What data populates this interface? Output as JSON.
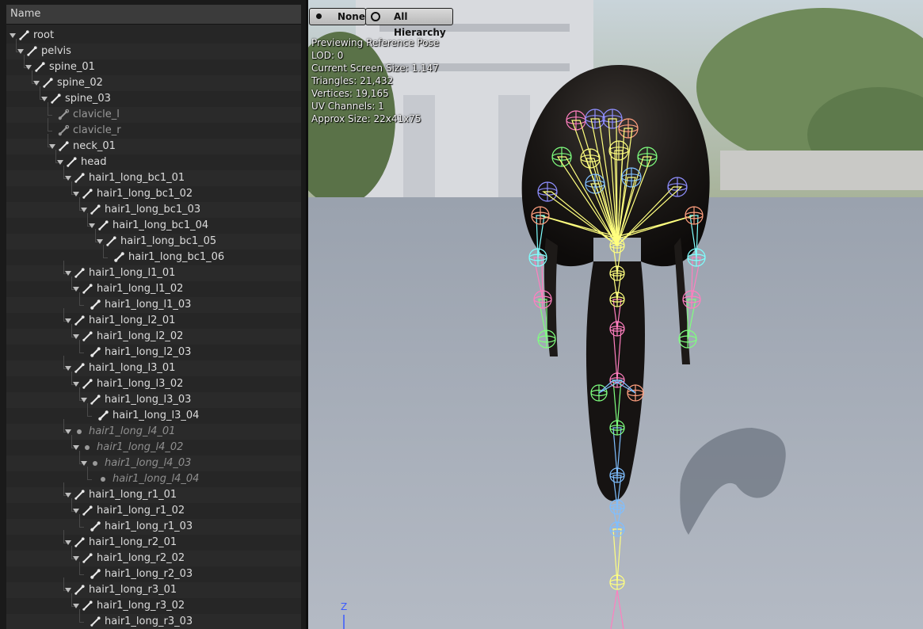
{
  "tree": {
    "header": "Name",
    "rows": [
      {
        "label": "root",
        "depth": 0,
        "expanded": true,
        "icon": "bone",
        "style": "normal"
      },
      {
        "label": "pelvis",
        "depth": 1,
        "expanded": true,
        "icon": "bone",
        "style": "normal"
      },
      {
        "label": "spine_01",
        "depth": 2,
        "expanded": true,
        "icon": "bone",
        "style": "normal"
      },
      {
        "label": "spine_02",
        "depth": 3,
        "expanded": true,
        "icon": "bone",
        "style": "normal"
      },
      {
        "label": "spine_03",
        "depth": 4,
        "expanded": true,
        "icon": "bone",
        "style": "normal"
      },
      {
        "label": "clavicle_l",
        "depth": 5,
        "expanded": false,
        "icon": "bone-outline",
        "style": "disabled"
      },
      {
        "label": "clavicle_r",
        "depth": 5,
        "expanded": false,
        "icon": "bone-outline",
        "style": "disabled"
      },
      {
        "label": "neck_01",
        "depth": 5,
        "expanded": true,
        "icon": "bone",
        "style": "normal"
      },
      {
        "label": "head",
        "depth": 6,
        "expanded": true,
        "icon": "bone",
        "style": "normal"
      },
      {
        "label": "hair1_long_bc1_01",
        "depth": 7,
        "expanded": true,
        "icon": "bone",
        "style": "normal"
      },
      {
        "label": "hair1_long_bc1_02",
        "depth": 8,
        "expanded": true,
        "icon": "bone",
        "style": "normal"
      },
      {
        "label": "hair1_long_bc1_03",
        "depth": 9,
        "expanded": true,
        "icon": "bone",
        "style": "normal"
      },
      {
        "label": "hair1_long_bc1_04",
        "depth": 10,
        "expanded": true,
        "icon": "bone",
        "style": "normal"
      },
      {
        "label": "hair1_long_bc1_05",
        "depth": 11,
        "expanded": true,
        "icon": "bone",
        "style": "normal"
      },
      {
        "label": "hair1_long_bc1_06",
        "depth": 12,
        "expanded": false,
        "icon": "bone-end",
        "style": "normal"
      },
      {
        "label": "hair1_long_l1_01",
        "depth": 7,
        "expanded": true,
        "icon": "bone",
        "style": "normal"
      },
      {
        "label": "hair1_long_l1_02",
        "depth": 8,
        "expanded": true,
        "icon": "bone",
        "style": "normal"
      },
      {
        "label": "hair1_long_l1_03",
        "depth": 9,
        "expanded": false,
        "icon": "bone-end",
        "style": "normal"
      },
      {
        "label": "hair1_long_l2_01",
        "depth": 7,
        "expanded": true,
        "icon": "bone",
        "style": "normal"
      },
      {
        "label": "hair1_long_l2_02",
        "depth": 8,
        "expanded": true,
        "icon": "bone",
        "style": "normal"
      },
      {
        "label": "hair1_long_l2_03",
        "depth": 9,
        "expanded": false,
        "icon": "bone-end",
        "style": "normal"
      },
      {
        "label": "hair1_long_l3_01",
        "depth": 7,
        "expanded": true,
        "icon": "bone",
        "style": "normal"
      },
      {
        "label": "hair1_long_l3_02",
        "depth": 8,
        "expanded": true,
        "icon": "bone",
        "style": "normal"
      },
      {
        "label": "hair1_long_l3_03",
        "depth": 9,
        "expanded": true,
        "icon": "bone",
        "style": "normal"
      },
      {
        "label": "hair1_long_l3_04",
        "depth": 10,
        "expanded": false,
        "icon": "bone-end",
        "style": "normal"
      },
      {
        "label": "hair1_long_l4_01",
        "depth": 7,
        "expanded": true,
        "icon": "dot",
        "style": "italic"
      },
      {
        "label": "hair1_long_l4_02",
        "depth": 8,
        "expanded": true,
        "icon": "dot",
        "style": "italic"
      },
      {
        "label": "hair1_long_l4_03",
        "depth": 9,
        "expanded": true,
        "icon": "dot",
        "style": "italic"
      },
      {
        "label": "hair1_long_l4_04",
        "depth": 10,
        "expanded": false,
        "icon": "dot",
        "style": "italic"
      },
      {
        "label": "hair1_long_r1_01",
        "depth": 7,
        "expanded": true,
        "icon": "bone",
        "style": "normal"
      },
      {
        "label": "hair1_long_r1_02",
        "depth": 8,
        "expanded": true,
        "icon": "bone",
        "style": "normal"
      },
      {
        "label": "hair1_long_r1_03",
        "depth": 9,
        "expanded": false,
        "icon": "bone-end",
        "style": "normal"
      },
      {
        "label": "hair1_long_r2_01",
        "depth": 7,
        "expanded": true,
        "icon": "bone",
        "style": "normal"
      },
      {
        "label": "hair1_long_r2_02",
        "depth": 8,
        "expanded": true,
        "icon": "bone",
        "style": "normal"
      },
      {
        "label": "hair1_long_r2_03",
        "depth": 9,
        "expanded": false,
        "icon": "bone-end",
        "style": "normal"
      },
      {
        "label": "hair1_long_r3_01",
        "depth": 7,
        "expanded": true,
        "icon": "bone",
        "style": "normal"
      },
      {
        "label": "hair1_long_r3_02",
        "depth": 8,
        "expanded": true,
        "icon": "bone",
        "style": "normal"
      },
      {
        "label": "hair1_long_r3_03",
        "depth": 9,
        "expanded": false,
        "icon": "bone",
        "style": "normal"
      }
    ]
  },
  "viewport": {
    "buttons": [
      {
        "label": "None",
        "icon": "filled-dot-icon"
      },
      {
        "label": "All Hierarchy",
        "icon": "ring-icon"
      }
    ],
    "stats": [
      "Previewing Reference Pose",
      "LOD: 0",
      "Current Screen Size: 1.147",
      "Triangles: 21,432",
      "Vertices: 19,165",
      "UV Channels: 1",
      "Approx Size: 22x41x75"
    ],
    "axis_label": "Z",
    "bone_colors": [
      "#ff7fbf",
      "#8f8fff",
      "#ffff7f",
      "#7fff7f",
      "#7fffff",
      "#ff9f7f",
      "#7fbfff"
    ]
  }
}
